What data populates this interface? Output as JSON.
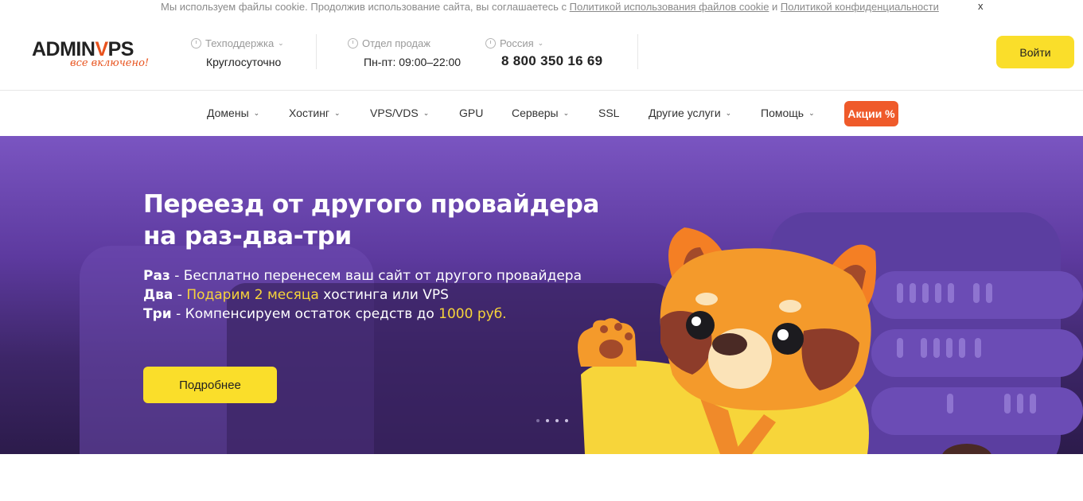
{
  "cookie": {
    "text_before": "Мы используем файлы cookie. Продолжив использование сайта, вы соглашаетесь с ",
    "link1": "Политикой использования файлов cookie",
    "text_and": " и ",
    "link2": "Политикой конфиденциальности",
    "close": "x"
  },
  "header": {
    "logo_main_left": "ADMIN",
    "logo_main_accent": "V",
    "logo_main_right": "PS",
    "logo_tagline": "все включено!",
    "support": {
      "label": "Техподдержка",
      "value": "Круглосуточно"
    },
    "sales": {
      "label": "Отдел продаж",
      "value": "Пн-пт: 09:00–22:00"
    },
    "region": {
      "label": "Россия",
      "phone": "8 800 350 16 69"
    },
    "login": "Войти"
  },
  "nav": {
    "items": [
      {
        "label": "Домены",
        "has_dropdown": true
      },
      {
        "label": "Хостинг",
        "has_dropdown": true
      },
      {
        "label": "VPS/VDS",
        "has_dropdown": true
      },
      {
        "label": "GPU",
        "has_dropdown": false
      },
      {
        "label": "Серверы",
        "has_dropdown": true
      },
      {
        "label": "SSL",
        "has_dropdown": false
      },
      {
        "label": "Другие услуги",
        "has_dropdown": true
      },
      {
        "label": "Помощь",
        "has_dropdown": true
      }
    ],
    "promo": "Акции %"
  },
  "hero": {
    "title_line1": "Переезд от другого провайдера",
    "title_line2": "на раз-два-три",
    "line1_bold": "Раз",
    "line1_text": " - Бесплатно перенесем ваш сайт от другого провайдера",
    "line2_bold": "Два",
    "line2_sep": " - ",
    "line2_highlight": "Подарим 2 месяца",
    "line2_text": " хостинга или VPS",
    "line3_bold": "Три",
    "line3_text": " - Компенсируем остаток средств до ",
    "line3_highlight": "1000 руб.",
    "button": "Подробнее",
    "slides_total": 4,
    "slide_active": 1
  },
  "colors": {
    "accent_yellow": "#fade2a",
    "accent_orange": "#ef5a2a",
    "hero_purple": "#6a45b3"
  }
}
